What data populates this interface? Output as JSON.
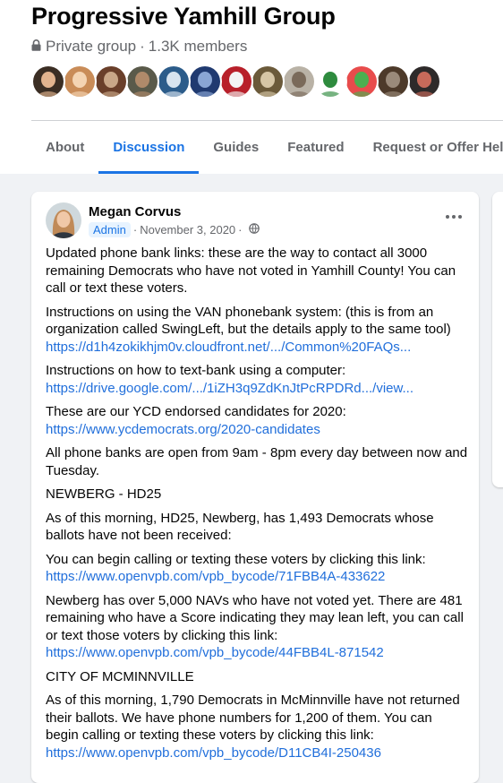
{
  "group": {
    "name": "Progressive Yamhill Group",
    "privacy": "Private group",
    "separator": "·",
    "members": "1.3K members"
  },
  "member_avatars": [
    {
      "name": "member-avatar",
      "colors": [
        "#3b2e24",
        "#e2b48f"
      ]
    },
    {
      "name": "member-avatar",
      "colors": [
        "#c98c58",
        "#f4d4b3"
      ]
    },
    {
      "name": "member-avatar",
      "colors": [
        "#6a3f2a",
        "#c9a788"
      ]
    },
    {
      "name": "member-avatar",
      "colors": [
        "#5a5a4a",
        "#b08a6a"
      ]
    },
    {
      "name": "member-avatar",
      "colors": [
        "#2c5c8a",
        "#d8e4ef"
      ]
    },
    {
      "name": "member-avatar",
      "colors": [
        "#203a70",
        "#8aa6d4"
      ]
    },
    {
      "name": "member-avatar",
      "colors": [
        "#b8202a",
        "#f3f3f3"
      ]
    },
    {
      "name": "member-avatar",
      "colors": [
        "#6b5a3a",
        "#d6c6a6"
      ]
    },
    {
      "name": "member-avatar",
      "colors": [
        "#b9b2a6",
        "#7a6a5a"
      ]
    },
    {
      "name": "member-avatar",
      "colors": [
        "#ffffff",
        "#2e8b3e"
      ]
    },
    {
      "name": "member-avatar",
      "colors": [
        "#e84c4c",
        "#4caf50"
      ]
    },
    {
      "name": "member-avatar",
      "colors": [
        "#4d3a2a",
        "#9a8a7a"
      ]
    },
    {
      "name": "member-avatar",
      "colors": [
        "#2e2a2a",
        "#c86a5a"
      ]
    }
  ],
  "tabs": [
    {
      "label": "About",
      "active": false
    },
    {
      "label": "Discussion",
      "active": true
    },
    {
      "label": "Guides",
      "active": false
    },
    {
      "label": "Featured",
      "active": false
    },
    {
      "label": "Request or Offer Help",
      "active": false
    }
  ],
  "post": {
    "author": "Megan Corvus",
    "badge": "Admin",
    "separator": "·",
    "date": "November 3, 2020",
    "separator2": "·",
    "paragraphs": [
      {
        "text": "Updated phone bank links: these are the way to contact all 3000 remaining Democrats who have not voted in Yamhill County!  You can call or text these voters.",
        "link": ""
      },
      {
        "text": "Instructions on using the VAN phonebank system: (this is from an organization called SwingLeft, but the details apply to the same tool)",
        "link": "https://d1h4zokikhjm0v.cloudfront.net/.../Common%20FAQs..."
      },
      {
        "text": "Instructions on how to text-bank using a computer:",
        "link": "https://drive.google.com/.../1iZH3q9ZdKnJtPcRPDRd.../view..."
      },
      {
        "text": "These are our YCD endorsed candidates for 2020:",
        "link": "https://www.ycdemocrats.org/2020-candidates"
      },
      {
        "text": "All phone banks are open from 9am - 8pm every day between now and Tuesday.",
        "link": ""
      },
      {
        "text": "NEWBERG - HD25",
        "link": ""
      },
      {
        "text": "As of this morning, HD25, Newberg, has 1,493 Democrats whose ballots have not been received:",
        "link": ""
      },
      {
        "text": "You can begin calling or texting these voters by clicking this link:",
        "link": "https://www.openvpb.com/vpb_bycode/71FBB4A-433622"
      },
      {
        "text": "Newberg has over 5,000 NAVs who have not voted yet.  There are 481 remaining who have a Score indicating they may lean left, you can call or text those voters by clicking this link:",
        "link": "https://www.openvpb.com/vpb_bycode/44FBB4L-871542"
      },
      {
        "text": "CITY OF MCMINNVILLE",
        "link": ""
      },
      {
        "text": "As of this morning, 1,790 Democrats in McMinnville have not returned their ballots.  We have phone numbers for 1,200 of them. You can begin calling or texting these voters by clicking this link:",
        "link": "https://www.openvpb.com/vpb_bycode/D11CB4I-250436"
      }
    ]
  },
  "colors": {
    "accent": "#1b74e4",
    "link": "#216fdb",
    "secondary_text": "#65676b",
    "background": "#f0f2f5"
  },
  "icons": {
    "privacy": "lock-icon",
    "audience": "globe-icon",
    "menu": "more-options-icon"
  }
}
